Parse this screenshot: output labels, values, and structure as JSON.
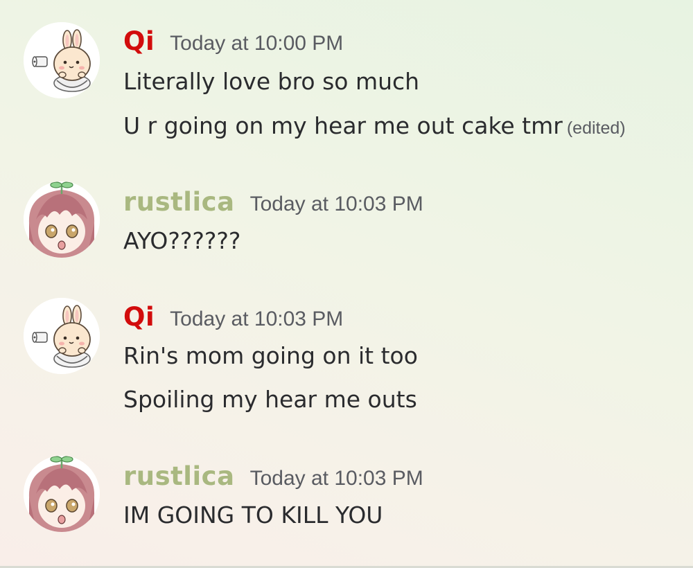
{
  "messages": [
    {
      "author": "Qi",
      "timestamp": "Today at 10:00 PM",
      "avatar_icon": "bunny-toilet-avatar",
      "lines": [
        "Literally love bro so much",
        "U r going on my hear me out cake tmr"
      ],
      "edited_label": "(edited)"
    },
    {
      "author": "rustlica",
      "timestamp": "Today at 10:03 PM",
      "avatar_icon": "pink-hair-sprout-avatar",
      "lines": [
        "AYO??????"
      ]
    },
    {
      "author": "Qi",
      "timestamp": "Today at 10:03 PM",
      "avatar_icon": "bunny-toilet-avatar",
      "lines": [
        "Rin's mom going on it too",
        "Spoiling my hear me outs"
      ]
    },
    {
      "author": "rustlica",
      "timestamp": "Today at 10:03 PM",
      "avatar_icon": "pink-hair-sprout-avatar",
      "lines": [
        "IM GOING TO KILL YOU"
      ]
    }
  ],
  "colors": {
    "qi_name": "#d20c0c",
    "rustlica_name": "#a9b880",
    "timestamp": "#595b61",
    "message_text": "#2a2b2e"
  }
}
